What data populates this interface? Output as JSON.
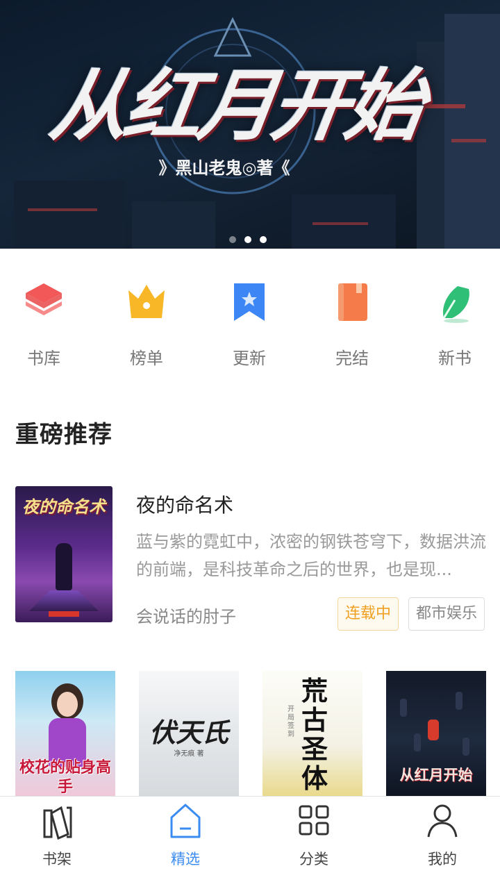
{
  "banner": {
    "title": "从红月开始",
    "author": "黑山老鬼◎著",
    "chevron_left": "》",
    "chevron_right": "《",
    "dots_count": 3,
    "active_dot_index": 1
  },
  "categories": [
    {
      "label": "书库",
      "icon": "layers-icon",
      "color": "#f25858"
    },
    {
      "label": "榜单",
      "icon": "crown-icon",
      "color": "#f7b726"
    },
    {
      "label": "更新",
      "icon": "bookmark-icon",
      "color": "#3d86f5"
    },
    {
      "label": "完结",
      "icon": "book-icon",
      "color": "#f57c4a"
    },
    {
      "label": "新书",
      "icon": "pen-icon",
      "color": "#2fbf76"
    }
  ],
  "section": {
    "title": "重磅推荐"
  },
  "featured": {
    "cover_title": "夜的命名术",
    "title": "夜的命名术",
    "description": "蓝与紫的霓虹中，浓密的钢铁苍穹下，数据洪流的前端，是科技革命之后的世界，也是现...",
    "author": "会说话的肘子",
    "status_tag": "连载中",
    "genre_tag": "都市娱乐"
  },
  "cover_row": [
    {
      "title": "校花的贴身高手"
    },
    {
      "title": "伏天氏",
      "subtitle": "净无痕 著"
    },
    {
      "title": "荒古圣体",
      "subtitle": "开局签到"
    },
    {
      "title": "从红月开始"
    }
  ],
  "tabbar": {
    "items": [
      {
        "label": "书架",
        "icon": "bookshelf-icon"
      },
      {
        "label": "精选",
        "icon": "home-icon",
        "active": true
      },
      {
        "label": "分类",
        "icon": "grid-icon"
      },
      {
        "label": "我的",
        "icon": "user-icon"
      }
    ],
    "active_color": "#3b8cf0"
  }
}
